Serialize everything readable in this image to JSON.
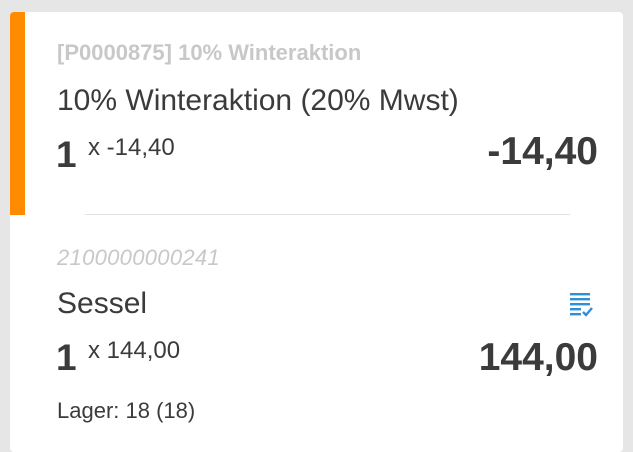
{
  "items": [
    {
      "code": "[P0000875] 10% Winteraktion",
      "name": "10% Winteraktion (20% Mwst)",
      "quantity": "1",
      "unit_price": "x -14,40",
      "total": "-14,40",
      "accent_color": "#ff8c00"
    },
    {
      "code": "2100000000241",
      "name": "Sessel",
      "quantity": "1",
      "unit_price": "x 144,00",
      "total": "144,00",
      "stock": "Lager: 18 (18)",
      "icon": "checklist-icon",
      "icon_color": "#2f8fd8"
    }
  ]
}
